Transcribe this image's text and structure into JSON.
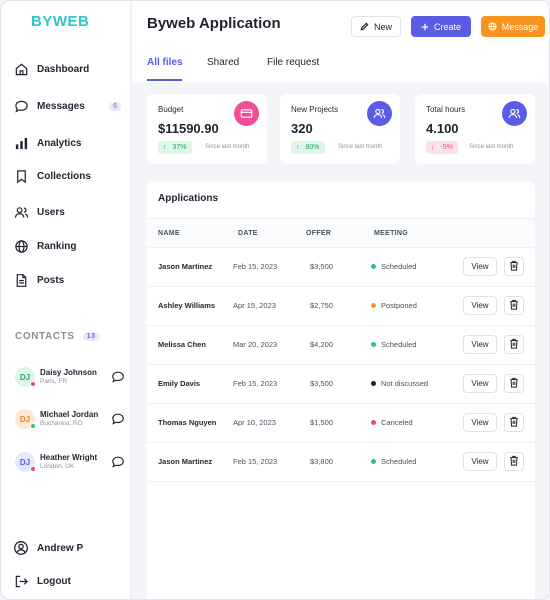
{
  "app": {
    "logo": "BYWEB",
    "title": "Byweb Application"
  },
  "sidebar": {
    "items": [
      {
        "label": "Dashboard",
        "icon": "home-icon"
      },
      {
        "label": "Messages",
        "icon": "chat-icon",
        "badge": "6"
      },
      {
        "label": "Analytics",
        "icon": "bar-chart-icon"
      },
      {
        "label": "Collections",
        "icon": "bookmark-icon"
      },
      {
        "label": "Users",
        "icon": "users-icon"
      },
      {
        "label": "Ranking",
        "icon": "globe-icon"
      },
      {
        "label": "Posts",
        "icon": "document-icon"
      }
    ],
    "contacts_heading": "CONTACTS",
    "contacts_count": "13",
    "contacts": [
      {
        "initials": "DJ",
        "name": "Daisy Johnson",
        "location": "Paris, FR",
        "avatar_bg": "#dff5ea",
        "avatar_fg": "#2fa86a",
        "status": "#e84a7f"
      },
      {
        "initials": "DJ",
        "name": "Michael Jordan",
        "location": "Bucharest, RO",
        "avatar_bg": "#fde9d6",
        "avatar_fg": "#e8861e",
        "status": "#2fc47a"
      },
      {
        "initials": "DJ",
        "name": "Heather Wright",
        "location": "London, UK",
        "avatar_bg": "#e6e6fb",
        "avatar_fg": "#5b5ce6",
        "status": "#e84a7f"
      }
    ],
    "user_name": "Andrew P",
    "logout_label": "Logout"
  },
  "header": {
    "new_label": "New",
    "create_label": "Create",
    "message_label": "Message",
    "tabs": [
      "All files",
      "Shared",
      "File request"
    ]
  },
  "stats": [
    {
      "title": "Budget",
      "value": "$11590.90",
      "change": "37%",
      "direction": "up",
      "since": "Since last month",
      "icon": "credit-card-icon",
      "icon_bg": "#ef4f96"
    },
    {
      "title": "New Projects",
      "value": "320",
      "change": "80%",
      "direction": "up",
      "since": "Since last month",
      "icon": "users-icon",
      "icon_bg": "#5b5ce6"
    },
    {
      "title": "Total hours",
      "value": "4.100",
      "change": "-5%",
      "direction": "down",
      "since": "Since last month",
      "icon": "users-icon",
      "icon_bg": "#5b5ce6"
    }
  ],
  "applications": {
    "title": "Applications",
    "columns": [
      "NAME",
      "DATE",
      "OFFER",
      "MEETING"
    ],
    "view_label": "View",
    "rows": [
      {
        "name": "Jason Martinez",
        "date": "Feb 15, 2023",
        "offer": "$3,500",
        "meeting": "Scheduled",
        "status_color": "#2fc47a"
      },
      {
        "name": "Ashley Williams",
        "date": "Apr 15, 2023",
        "offer": "$2,750",
        "meeting": "Postponed",
        "status_color": "#f7931e"
      },
      {
        "name": "Melissa Chen",
        "date": "Mar 20, 2023",
        "offer": "$4,200",
        "meeting": "Scheduled",
        "status_color": "#2fc47a"
      },
      {
        "name": "Emily Davis",
        "date": "Feb 15, 2023",
        "offer": "$3,500",
        "meeting": "Not discussed",
        "status_color": "#1f2430"
      },
      {
        "name": "Thomas Nguyen",
        "date": "Apr 10, 2023",
        "offer": "$1,500",
        "meeting": "Canceled",
        "status_color": "#e84a7f"
      },
      {
        "name": "Jason Martinez",
        "date": "Feb 15, 2023",
        "offer": "$3,800",
        "meeting": "Scheduled",
        "status_color": "#2fc47a"
      }
    ]
  },
  "colors": {
    "accent": "#5b5ce6",
    "orange": "#f7931e",
    "logo": "#2fc5c9",
    "positive_bg": "#dcf7ea",
    "positive_fg": "#2a9d63",
    "negative_bg": "#fde2ea",
    "negative_fg": "#e84a7f"
  }
}
